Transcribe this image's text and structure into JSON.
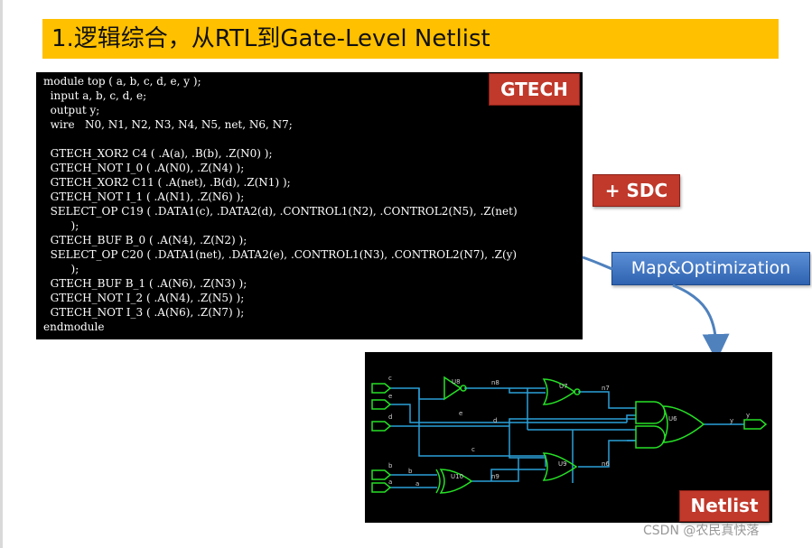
{
  "title": "1.逻辑综合，从RTL到Gate-Level Netlist",
  "badges": {
    "gtech": "GTECH",
    "sdc": "+ SDC",
    "map": "Map&Optimization",
    "netlist": "Netlist"
  },
  "code": {
    "lines": [
      "module top ( a, b, c, d, e, y );",
      "  input a, b, c, d, e;",
      "  output y;",
      "  wire   N0, N1, N2, N3, N4, N5, net, N6, N7;",
      "",
      "  GTECH_XOR2 C4 ( .A(a), .B(b), .Z(N0) );",
      "  GTECH_NOT I_0 ( .A(N0), .Z(N4) );",
      "  GTECH_XOR2 C11 ( .A(net), .B(d), .Z(N1) );",
      "  GTECH_NOT I_1 ( .A(N1), .Z(N6) );",
      "  SELECT_OP C19 ( .DATA1(c), .DATA2(d), .CONTROL1(N2), .CONTROL2(N5), .Z(net)",
      "        );",
      "  GTECH_BUF B_0 ( .A(N4), .Z(N2) );",
      "  SELECT_OP C20 ( .DATA1(net), .DATA2(e), .CONTROL1(N3), .CONTROL2(N7), .Z(y)",
      "        );",
      "  GTECH_BUF B_1 ( .A(N6), .Z(N3) );",
      "  GTECH_NOT I_2 ( .A(N4), .Z(N5) );",
      "  GTECH_NOT I_3 ( .A(N6), .Z(N7) );",
      "endmodule"
    ]
  },
  "netlist": {
    "inputs": [
      "c",
      "e",
      "d",
      "b",
      "a"
    ],
    "output": "y",
    "gates": [
      "U8",
      "U7",
      "U6",
      "U9",
      "U10"
    ],
    "nets": [
      "n8",
      "n7",
      "e",
      "d",
      "c",
      "b",
      "a",
      "n9",
      "n6",
      "y"
    ]
  },
  "watermark": "CSDN @农民真快落"
}
